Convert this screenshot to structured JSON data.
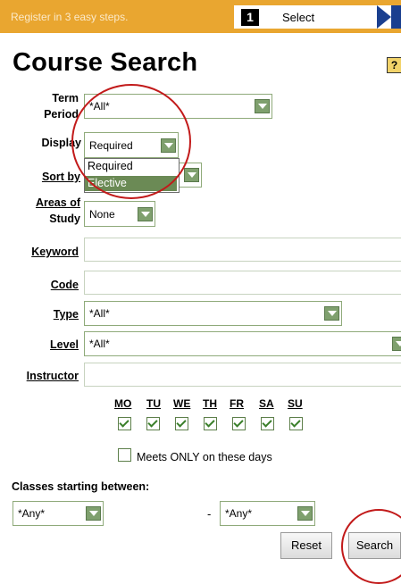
{
  "topbar": {
    "steps_text": "Register in 3 easy steps.",
    "step_number": "1",
    "step_label": "Select"
  },
  "page": {
    "title": "Course Search",
    "help_icon": "?"
  },
  "form": {
    "term_period": {
      "label_line1": "Term",
      "label_line2": "Period",
      "value": "*All*"
    },
    "display": {
      "label": "Display",
      "value": "Required",
      "options": [
        "Required",
        "Elective"
      ],
      "highlighted": "Elective"
    },
    "sort_by": {
      "label": "Sort by"
    },
    "areas_of_study": {
      "label_line1": "Areas of",
      "label_line2": "Study",
      "value": "None"
    },
    "keyword": {
      "label": "Keyword",
      "value": ""
    },
    "code": {
      "label": "Code",
      "value": ""
    },
    "type": {
      "label": "Type",
      "value": "*All*"
    },
    "level": {
      "label": "Level",
      "value": "*All*"
    },
    "instructor": {
      "label": "Instructor",
      "value": ""
    },
    "days": [
      "MO",
      "TU",
      "WE",
      "TH",
      "FR",
      "SA",
      "SU"
    ],
    "meets_only": {
      "label": "Meets ONLY on these days"
    },
    "classes_between": {
      "label": "Classes starting between:",
      "from": "*Any*",
      "dash": "-",
      "to": "*Any*"
    },
    "buttons": {
      "reset": "Reset",
      "search": "Search"
    }
  },
  "colors": {
    "topbar": "#e9a630",
    "accent_green": "#7fa06e",
    "annotation_red": "#c21a1a"
  }
}
